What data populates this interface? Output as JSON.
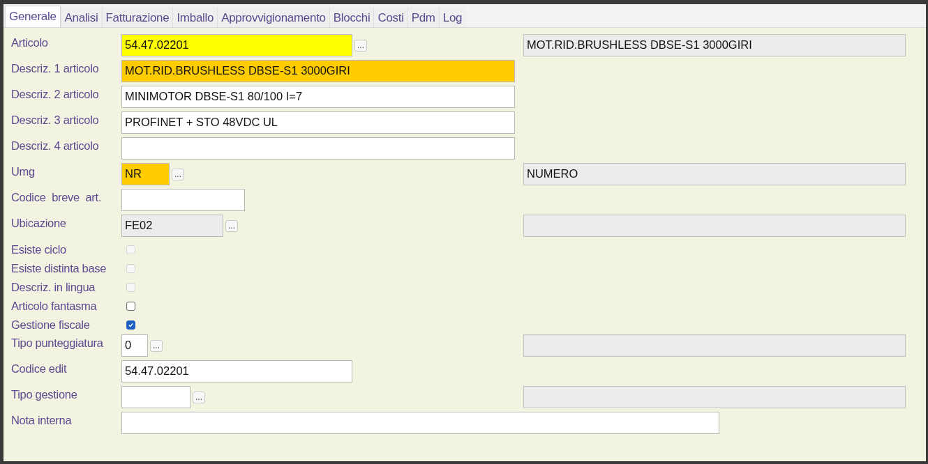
{
  "tabs": [
    {
      "label": "Generale",
      "selected": true
    },
    {
      "label": "Analisi",
      "selected": false
    },
    {
      "label": "Fatturazione",
      "selected": false
    },
    {
      "label": "Imballo",
      "selected": false
    },
    {
      "label": "Approvvigionamento",
      "selected": false
    },
    {
      "label": "Blocchi",
      "selected": false
    },
    {
      "label": "Costi",
      "selected": false
    },
    {
      "label": "Pdm",
      "selected": false
    },
    {
      "label": "Log",
      "selected": false
    }
  ],
  "fields": [
    {
      "kind": "text",
      "label": "Articolo",
      "value": "54.47.02201",
      "color": "#ffff00",
      "readonly": false,
      "lookup": "...",
      "side_field": {
        "readonly": true,
        "value": "MOT.RID.BRUSHLESS DBSE-S1 3000GIRI"
      }
    },
    {
      "kind": "text",
      "label": "Descriz. 1 articolo",
      "value": "MOT.RID.BRUSHLESS DBSE-S1 3000GIRI",
      "color": "#ffcc00",
      "readonly": false
    },
    {
      "kind": "text",
      "label": "Descriz. 2 articolo",
      "value": "MINIMOTOR DBSE-S1 80/100 I=7",
      "readonly": false
    },
    {
      "kind": "text",
      "label": "Descriz. 3 articolo",
      "value": "PROFINET + STO 48VDC UL",
      "readonly": false
    },
    {
      "kind": "text",
      "label": "Descriz. 4 articolo",
      "readonly": false
    },
    {
      "kind": "text",
      "label": "Umg",
      "value": "NR",
      "color": "#ffcc00",
      "readonly": false,
      "lookup": "...",
      "side_field": {
        "readonly": true,
        "value": "NUMERO"
      }
    },
    {
      "kind": "text",
      "label": "Codice  breve  art.",
      "readonly": false
    },
    {
      "kind": "text",
      "label": "Ubicazione",
      "value": "FE02",
      "readonly": true,
      "lookup": "...",
      "side_field": {
        "readonly": true
      }
    },
    {
      "kind": "checkbox",
      "label": "Esiste ciclo",
      "checked": false,
      "disabled": true
    },
    {
      "kind": "checkbox",
      "label": "Esiste distinta base",
      "checked": false,
      "disabled": true
    },
    {
      "kind": "checkbox",
      "label": "Descriz. in lingua",
      "checked": false,
      "disabled": true
    },
    {
      "kind": "checkbox",
      "label": "Articolo fantasma",
      "checked": false,
      "disabled": false
    },
    {
      "kind": "checkbox",
      "label": "Gestione fiscale",
      "checked": true,
      "disabled": false
    },
    {
      "kind": "text",
      "label": "Tipo punteggiatura",
      "value": "0",
      "readonly": false,
      "lookup": "...",
      "side_field": {
        "readonly": true
      }
    },
    {
      "kind": "text",
      "label": "Codice edit",
      "value": "54.47.02201",
      "readonly": false
    },
    {
      "kind": "text",
      "label": "Tipo gestione",
      "readonly": false,
      "lookup": "...",
      "side_field": {
        "readonly": true
      }
    },
    {
      "kind": "text",
      "label": "Nota interna",
      "readonly": false
    }
  ]
}
